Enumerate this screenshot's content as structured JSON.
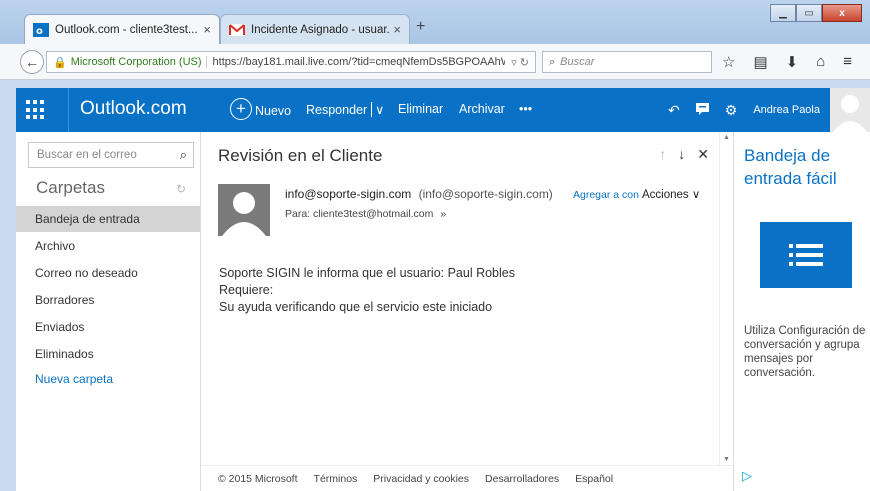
{
  "browser": {
    "tabs": [
      {
        "label": "Outlook.com - cliente3test...",
        "close": "×"
      },
      {
        "label": "Incidente Asignado - usuar...",
        "close": "×"
      }
    ],
    "new_tab": "+",
    "window_controls": {
      "min": "▁",
      "max": "▭",
      "close": "x"
    },
    "org_label": "Microsoft Corporation (US)",
    "url": "https://bay181.mail.live.com/?tid=cmeqNfemDs5BGPOAAhWt",
    "search_placeholder": "Buscar"
  },
  "header": {
    "brand": "Outlook.com",
    "commands": {
      "new": "Nuevo",
      "reply": "Responder",
      "delete": "Eliminar",
      "archive": "Archivar",
      "more": "•••"
    },
    "user_name": "Andrea Paola"
  },
  "sidebar": {
    "search_placeholder": "Buscar en el correo",
    "folders_title": "Carpetas",
    "items": [
      {
        "label": "Bandeja de entrada",
        "selected": true
      },
      {
        "label": "Archivo"
      },
      {
        "label": "Correo no deseado"
      },
      {
        "label": "Borradores"
      },
      {
        "label": "Enviados"
      },
      {
        "label": "Eliminados"
      }
    ],
    "new_folder": "Nueva carpeta"
  },
  "message": {
    "subject": "Revisión en el Cliente",
    "sender_name": "info@soporte-sigin.com",
    "sender_address": "(info@soporte-sigin.com)",
    "add_contact": "Agregar a con",
    "actions": "Acciones",
    "to_line": "Para: cliente3test@hotmail.com",
    "body_lines": [
      "Soporte SIGIN le informa que el usuario: Paul Robles",
      "Requiere:",
      "Su ayuda verificando que el servicio este iniciado"
    ]
  },
  "footer": {
    "copyright": "© 2015 Microsoft",
    "links": [
      "Términos",
      "Privacidad y cookies",
      "Desarrolladores",
      "Español"
    ]
  },
  "promo": {
    "title": "Bandeja de entrada fácil",
    "text": "Utiliza Configuración de conversación y agrupa mensajes por conversación."
  },
  "colors": {
    "brand_blue": "#0a72c6",
    "selected_folder": "#d4d4d4"
  }
}
